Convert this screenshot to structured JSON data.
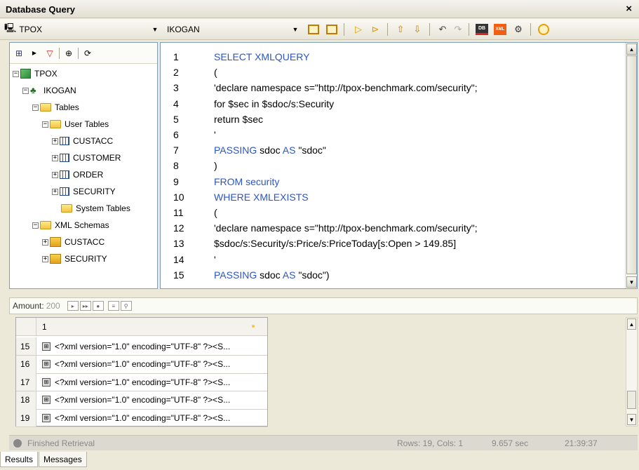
{
  "window": {
    "title": "Database Query",
    "close_icon": "close-icon"
  },
  "toolbar": {
    "connection_value": "TPOX",
    "schema_value": "IKOGAN",
    "buttons": [
      {
        "name": "layout-1-icon"
      },
      {
        "name": "layout-2-icon"
      },
      {
        "name": "run-icon"
      },
      {
        "name": "run-step-icon"
      },
      {
        "name": "export-icon"
      },
      {
        "name": "import-icon"
      },
      {
        "name": "undo-icon"
      },
      {
        "name": "redo-icon"
      },
      {
        "name": "db-cancel-icon"
      },
      {
        "name": "xml-icon"
      },
      {
        "name": "tools-icon"
      },
      {
        "name": "commit-icon"
      }
    ]
  },
  "tree": {
    "root": "TPOX",
    "user": "IKOGAN",
    "tables": "Tables",
    "user_tables": "User Tables",
    "items": [
      "CUSTACC",
      "CUSTOMER",
      "ORDER",
      "SECURITY"
    ],
    "system_tables": "System Tables",
    "xml_schemas": "XML Schemas",
    "schemas": [
      "CUSTACC",
      "SECURITY"
    ]
  },
  "editor": {
    "lines": [
      {
        "n": "1",
        "t": "SELECT XMLQUERY",
        "kw": true
      },
      {
        "n": "2",
        "t": "(",
        "kw": false
      },
      {
        "n": "3",
        "t": "'declare namespace s=\"http://tpox-benchmark.com/security\";",
        "kw": false
      },
      {
        "n": "4",
        "t": "for $sec in $sdoc/s:Security",
        "kw": false
      },
      {
        "n": "5",
        "t": "return $sec",
        "kw": false
      },
      {
        "n": "6",
        "t": "'",
        "kw": false
      },
      {
        "n": "7",
        "t": "PASSING",
        "kw": true,
        "rest": " sdoc ",
        "kw2": "AS",
        "rest2": " \"sdoc\""
      },
      {
        "n": "8",
        "t": ")",
        "kw": false
      },
      {
        "n": "9",
        "t": "FROM security",
        "kw": true
      },
      {
        "n": "10",
        "t": "WHERE XMLEXISTS",
        "kw": true
      },
      {
        "n": "11",
        "t": "(",
        "kw": false
      },
      {
        "n": "12",
        "t": "'declare namespace s=\"http://tpox-benchmark.com/security\";",
        "kw": false
      },
      {
        "n": "13",
        "t": "$sdoc/s:Security/s:Price/s:PriceToday[s:Open > 149.85]",
        "kw": false
      },
      {
        "n": "14",
        "t": "'",
        "kw": false
      },
      {
        "n": "15",
        "t": "PASSING",
        "kw": true,
        "rest": " sdoc ",
        "kw2": "AS",
        "rest2": " \"sdoc\")"
      }
    ]
  },
  "results": {
    "amount_label": "Amount:",
    "amount_value": "200",
    "column_header": "1",
    "rows": [
      {
        "n": "15",
        "v": "<?xml version=\"1.0\" encoding=\"UTF-8\" ?><S..."
      },
      {
        "n": "16",
        "v": "<?xml version=\"1.0\" encoding=\"UTF-8\" ?><S..."
      },
      {
        "n": "17",
        "v": "<?xml version=\"1.0\" encoding=\"UTF-8\" ?><S..."
      },
      {
        "n": "18",
        "v": "<?xml version=\"1.0\" encoding=\"UTF-8\" ?><S..."
      },
      {
        "n": "19",
        "v": "<?xml version=\"1.0\" encoding=\"UTF-8\" ?><S..."
      }
    ]
  },
  "status": {
    "text": "Finished Retrieval",
    "rows_cols": "Rows: 19, Cols: 1",
    "duration": "9.657 sec",
    "time": "21:39:37"
  },
  "tabs": [
    "Results",
    "Messages"
  ],
  "colors": {
    "keyword": "#2b55c9",
    "border": "#7f9db9"
  }
}
